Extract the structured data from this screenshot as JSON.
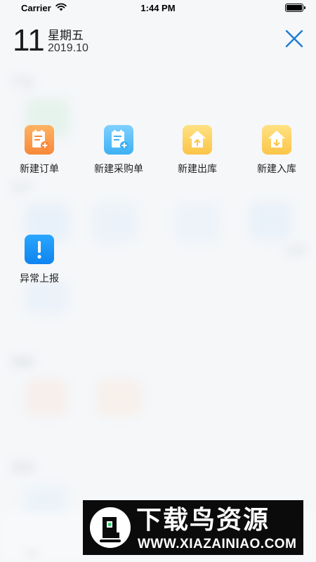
{
  "status_bar": {
    "carrier": "Carrier",
    "time": "1:44 PM"
  },
  "header": {
    "day": "11",
    "weekday": "星期五",
    "year_month": "2019.10"
  },
  "actions": [
    {
      "label": "新建订单",
      "icon": "new-order-icon",
      "color": "#f7893a"
    },
    {
      "label": "新建采购单",
      "icon": "new-purchase-order-icon",
      "color": "#3eb1f3"
    },
    {
      "label": "新建出库",
      "icon": "stock-out-icon",
      "color": "#fbc548"
    },
    {
      "label": "新建入库",
      "icon": "stock-in-icon",
      "color": "#fbc548"
    },
    {
      "label": "异常上报",
      "icon": "exception-report-icon",
      "color": "#0d84f0"
    }
  ],
  "background": {
    "sections": [
      "产品",
      "生产",
      "销售",
      "采购"
    ],
    "partial_labels": [
      "记录",
      "任务"
    ]
  },
  "watermark": {
    "title": "下载鸟资源",
    "url": "WWW.XIAZAINIAO.COM"
  },
  "colors": {
    "accent": "#1f7bd6",
    "text": "#222222"
  }
}
